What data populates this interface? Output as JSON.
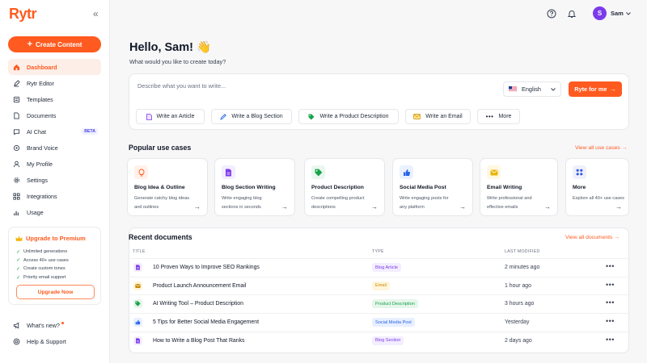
{
  "app": {
    "logo_text": "Rytr",
    "brand_color": "#ff5a1f"
  },
  "sidebar": {
    "collapse_icon": "«",
    "create_label": "Create Content",
    "items": [
      {
        "label": "Dashboard",
        "icon": "home-icon",
        "active": true
      },
      {
        "label": "Rytr Editor",
        "icon": "pen-icon"
      },
      {
        "label": "Templates",
        "icon": "templates-icon"
      },
      {
        "label": "Documents",
        "icon": "documents-icon"
      },
      {
        "label": "AI Chat",
        "icon": "chat-icon",
        "badge": "BETA"
      },
      {
        "label": "Brand Voice",
        "icon": "brand-voice-icon"
      },
      {
        "label": "My Profile",
        "icon": "profile-icon"
      },
      {
        "label": "Settings",
        "icon": "settings-icon"
      },
      {
        "label": "Integrations",
        "icon": "integrations-icon"
      },
      {
        "label": "Usage",
        "icon": "usage-icon"
      }
    ],
    "premium": {
      "title": "Upgrade to Premium",
      "features": [
        "Unlimited generations",
        "Access 40+ use cases",
        "Create custom tones",
        "Priority email support"
      ],
      "button_label": "Upgrade Now"
    },
    "whats_new": "What's new?",
    "help": "Help & Support"
  },
  "header": {
    "user_initial": "S",
    "user_name": "Sam"
  },
  "main": {
    "greeting": "Hello, Sam! 👋",
    "subtitle": "What would you like to create today?",
    "prompt": {
      "placeholder": "Describe what you want to write...",
      "language": "English",
      "submit_label": "Ryte for me",
      "quick_actions": [
        "Write an Article",
        "Write a Blog Section",
        "Write a Product Description",
        "Write an Email",
        "More"
      ]
    },
    "use_cases": {
      "title": "Popular use cases",
      "view_all": "View all use cases →",
      "cards": [
        {
          "title": "Blog Idea & Outline",
          "desc": "Generate catchy blog ideas and outlines",
          "icon": "lightbulb-icon",
          "color": "#ff5a1f",
          "bg": "#fff1ea"
        },
        {
          "title": "Blog Section Writing",
          "desc": "Write engaging blog sections in seconds",
          "icon": "document-icon",
          "color": "#7c3aed",
          "bg": "#f3edff"
        },
        {
          "title": "Product Description",
          "desc": "Create compelling product descriptions",
          "icon": "tag-icon",
          "color": "#16a34a",
          "bg": "#eaf7ee"
        },
        {
          "title": "Social Media Post",
          "desc": "Write engaging posts for any platform",
          "icon": "thumbs-up-icon",
          "color": "#2563eb",
          "bg": "#eaf1ff"
        },
        {
          "title": "Email Writing",
          "desc": "Write professional and effective emails",
          "icon": "envelope-icon",
          "color": "#eab308",
          "bg": "#fff8e1"
        },
        {
          "title": "More",
          "desc": "Explore all 40+ use cases",
          "icon": "grid-icon",
          "color": "#3b5bdb",
          "bg": "#eef1fb"
        }
      ]
    },
    "recent": {
      "title": "Recent documents",
      "view_all": "View all documents →",
      "columns": [
        "TITLE",
        "TYPE",
        "LAST MODIFIED"
      ],
      "rows": [
        {
          "title": "10 Proven Ways to Improve SEO Rankings",
          "type": "Blog Article",
          "modified": "2 minutes ago",
          "icon": "document-icon",
          "color": "#7c3aed",
          "bg": "#f3edff"
        },
        {
          "title": "Product Launch Announcement Email",
          "type": "Email",
          "modified": "1 hour ago",
          "icon": "envelope-icon",
          "color": "#ca8a04",
          "bg": "#fff5db"
        },
        {
          "title": "AI Writing Tool – Product Description",
          "type": "Product Description",
          "modified": "3 hours ago",
          "icon": "tag-icon",
          "color": "#16a34a",
          "bg": "#e6f6ea"
        },
        {
          "title": "5 Tips for Better Social Media Engagement",
          "type": "Social Media Post",
          "modified": "Yesterday",
          "icon": "thumbs-up-icon",
          "color": "#2563eb",
          "bg": "#e8f0ff"
        },
        {
          "title": "How to Write a Blog Post That Ranks",
          "type": "Blog Section",
          "modified": "2 days ago",
          "icon": "document-icon",
          "color": "#7c3aed",
          "bg": "#f3edff"
        }
      ]
    }
  }
}
